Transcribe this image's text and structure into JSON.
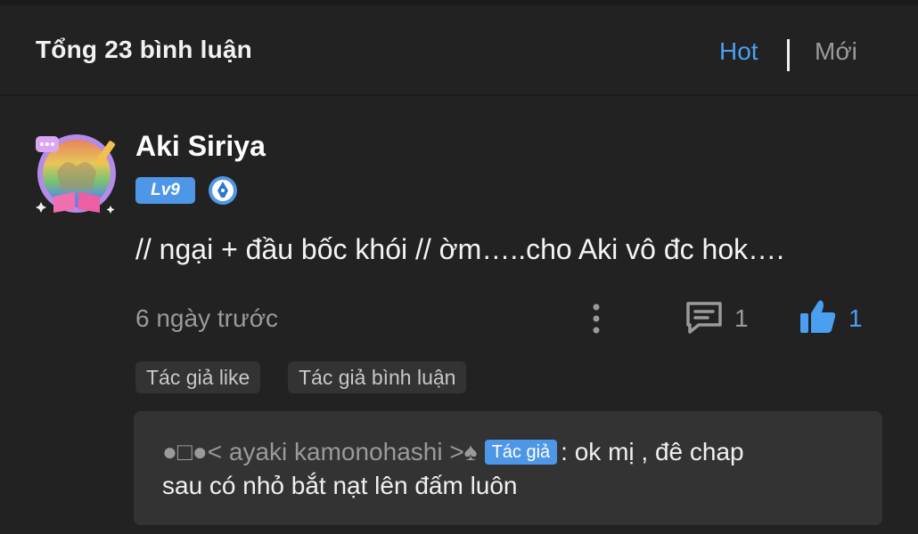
{
  "header": {
    "title": "Tổng 23 bình luận",
    "sort_hot": "Hot",
    "sort_new": "Mới",
    "active_sort": "Hot"
  },
  "comment": {
    "author": "Aki Siriya",
    "level": "Lv9",
    "text": "// ngại + đầu bốc khói // ờm…..cho Aki vô đc hok….",
    "time": "6 ngày trước",
    "reply_count": "1",
    "like_count": "1",
    "tags": [
      "Tác giả like",
      "Tác giả bình luận"
    ]
  },
  "reply": {
    "author": "●□●< ayaki kamonohashi >♠",
    "author_tag": "Tác giả",
    "text_line1": ": ok mị , đê chap",
    "text_line2": "sau có nhỏ bắt nạt lên đấm luôn"
  },
  "icons": {
    "pen_badge": "fountain-pen-icon",
    "more": "more-vertical-icon",
    "reply": "comment-icon",
    "like": "thumbs-up-icon"
  },
  "colors": {
    "background": "#222222",
    "accent": "#4a9ff0",
    "muted": "#9a9a9a",
    "tag_bg": "#333333"
  }
}
